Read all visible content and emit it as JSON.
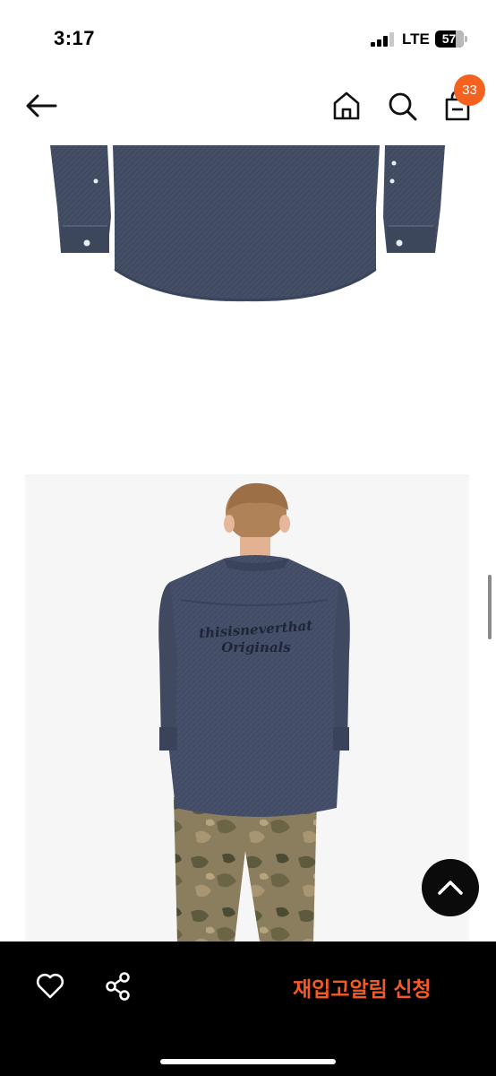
{
  "status": {
    "time": "3:17",
    "network": "LTE",
    "battery": "57"
  },
  "nav": {
    "cart_count": "33"
  },
  "product_images": [
    {
      "subject": "shirt-flat-lay",
      "color": "#434d63"
    },
    {
      "subject": "model-back-view",
      "background": "#f6f6f6"
    }
  ],
  "shirt_print": {
    "line1": "thisisneverthat",
    "line2": "Originals"
  },
  "bottom_bar": {
    "restock_alert_label": "재입고알림 신청"
  },
  "icons": [
    "back-arrow-icon",
    "home-icon",
    "search-icon",
    "shopping-bag-icon",
    "heart-icon",
    "share-icon",
    "chevron-up-icon"
  ],
  "colors": {
    "accent": "#f45a24",
    "badge": "#f5621f",
    "bar": "#000000"
  }
}
